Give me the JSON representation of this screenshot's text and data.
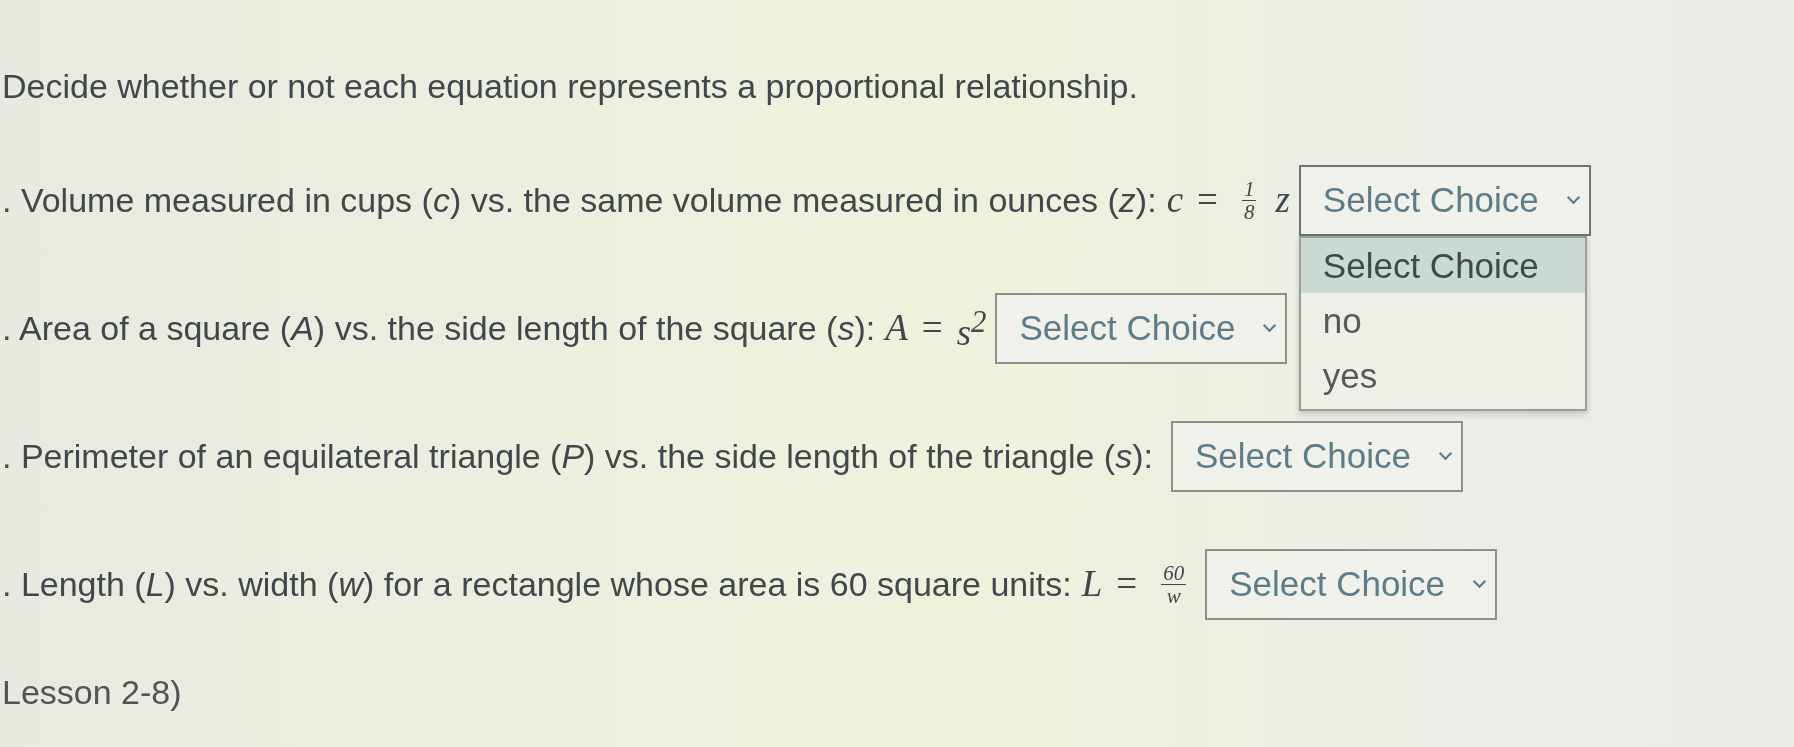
{
  "instructions": "Decide whether or not each equation represents a proportional relationship.",
  "items": [
    {
      "prompt": ". Volume measured in cups (*c*) vs. the same volume measured in ounces (*z*):",
      "equation": [
        {
          "kind": "var",
          "text": "c"
        },
        {
          "kind": "op",
          "text": "="
        },
        {
          "kind": "frac",
          "num": "1",
          "den": "8"
        },
        {
          "kind": "var",
          "text": "z"
        }
      ],
      "dropdown": {
        "value": "Select Choice",
        "expanded": true,
        "options": [
          {
            "label": "Select Choice",
            "selected": true
          },
          {
            "label": "no",
            "selected": false
          },
          {
            "label": "yes",
            "selected": false
          }
        ]
      }
    },
    {
      "prompt": ". Area of a square (*A*) vs. the side length of the square (*s*):",
      "equation": [
        {
          "kind": "var",
          "text": "A"
        },
        {
          "kind": "op",
          "text": "="
        },
        {
          "kind": "var",
          "text": "s$^{2}$"
        }
      ],
      "dropdown": {
        "value": "Select Choice",
        "expanded": false
      }
    },
    {
      "prompt": ". Perimeter of an equilateral triangle (*P*) vs. the side length of the triangle (*s*):",
      "dropdown": {
        "value": "Select Choice",
        "expanded": false
      }
    },
    {
      "prompt": ". Length (*L*) vs. width (*w*) for a rectangle whose area is 60 square units:",
      "equation": [
        {
          "kind": "var",
          "text": "L"
        },
        {
          "kind": "op",
          "text": "="
        },
        {
          "kind": "frac",
          "num": "60",
          "den": "w"
        }
      ],
      "dropdown": {
        "value": "Select Choice",
        "expanded": false
      }
    }
  ],
  "footer": "Lesson 2-8)"
}
